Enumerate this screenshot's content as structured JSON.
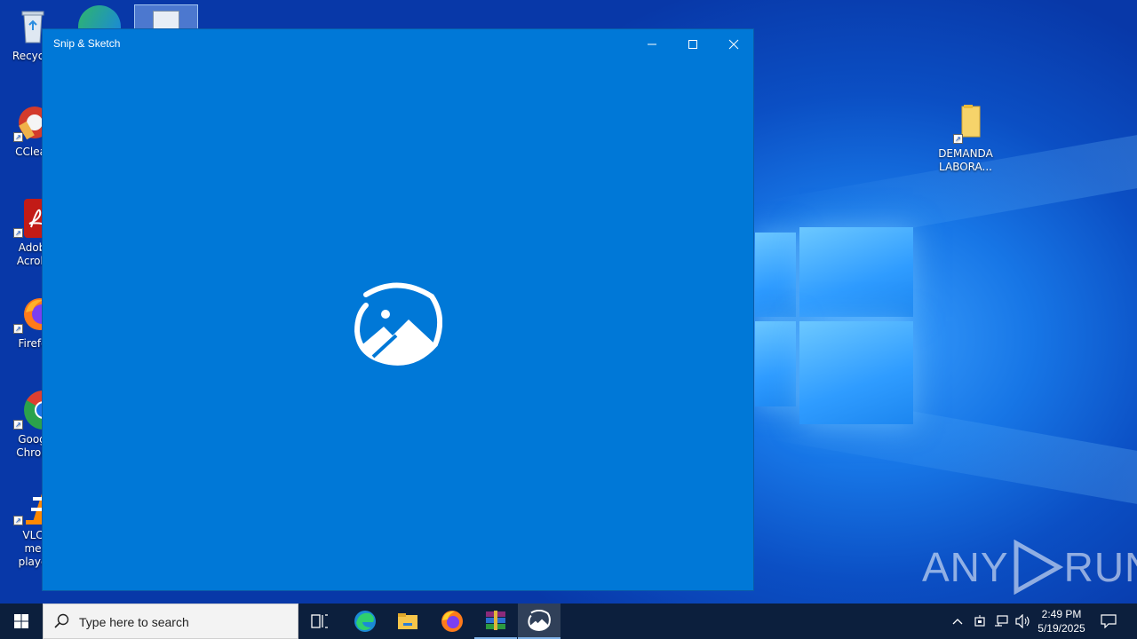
{
  "desktop": {
    "icons": [
      {
        "label": "Recycle",
        "icon": "recycle-bin-icon"
      },
      {
        "label": "CClear",
        "icon": "ccleaner-icon"
      },
      {
        "label": "Adob Acrob",
        "icon": "adobe-acrobat-icon"
      },
      {
        "label": "Firefo",
        "icon": "firefox-icon"
      },
      {
        "label": "Goog Chron",
        "icon": "google-chrome-icon"
      },
      {
        "label": "VLC me playe",
        "icon": "vlc-icon"
      }
    ],
    "folder": {
      "label": "DEMANDA LABORA...",
      "icon": "folder-icon"
    },
    "watermark": {
      "left": "ANY",
      "right": "RUN"
    }
  },
  "window": {
    "title": "Snip & Sketch",
    "accent": "#0078d7",
    "controls": [
      "minimize-icon",
      "maximize-icon",
      "close-icon"
    ]
  },
  "taskbar": {
    "search_placeholder": "Type here to search",
    "apps": [
      "task-view-icon",
      "edge-icon",
      "file-explorer-icon",
      "firefox-icon",
      "winrar-icon",
      "snip-sketch-icon"
    ],
    "clock": {
      "time": "2:49 PM",
      "date": "5/19/2025"
    }
  }
}
